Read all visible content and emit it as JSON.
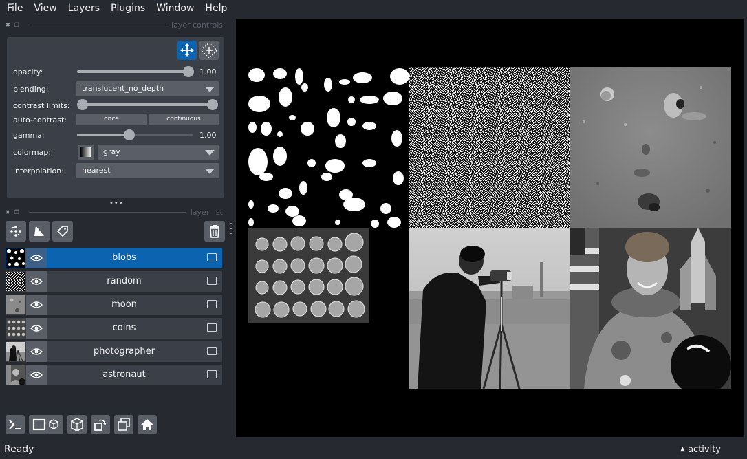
{
  "menu": [
    {
      "accel": "F",
      "rest": "ile"
    },
    {
      "accel": "V",
      "rest": "iew"
    },
    {
      "accel": "L",
      "rest": "ayers"
    },
    {
      "accel": "P",
      "rest": "lugins"
    },
    {
      "accel": "W",
      "rest": "indow"
    },
    {
      "accel": "H",
      "rest": "elp"
    }
  ],
  "layer_controls": {
    "dock_title": "layer controls",
    "opacity": {
      "label": "opacity:",
      "value": "1.00",
      "fraction": 1.0
    },
    "blending": {
      "label": "blending:",
      "selected": "translucent_no_depth"
    },
    "contrast_limits": {
      "label": "contrast limits:",
      "low_fraction": 0.0,
      "high_fraction": 1.0
    },
    "auto_contrast": {
      "label": "auto-contrast:",
      "once": "once",
      "continuous": "continuous"
    },
    "gamma": {
      "label": "gamma:",
      "value": "1.00",
      "fraction": 0.45
    },
    "colormap": {
      "label": "colormap:",
      "selected": "gray"
    },
    "interpolation": {
      "label": "interpolation:",
      "selected": "nearest"
    }
  },
  "layer_list": {
    "dock_title": "layer list",
    "layers": [
      {
        "name": "blobs",
        "selected": true
      },
      {
        "name": "random",
        "selected": false
      },
      {
        "name": "moon",
        "selected": false
      },
      {
        "name": "coins",
        "selected": false
      },
      {
        "name": "photographer",
        "selected": false
      },
      {
        "name": "astronaut",
        "selected": false
      }
    ]
  },
  "status": {
    "text": "Ready",
    "activity": "activity"
  },
  "colors": {
    "background": "#262930",
    "panel": "#3b3f47",
    "control": "#5a5e66",
    "accent": "#0c64b0",
    "text": "#f0f1f2"
  }
}
